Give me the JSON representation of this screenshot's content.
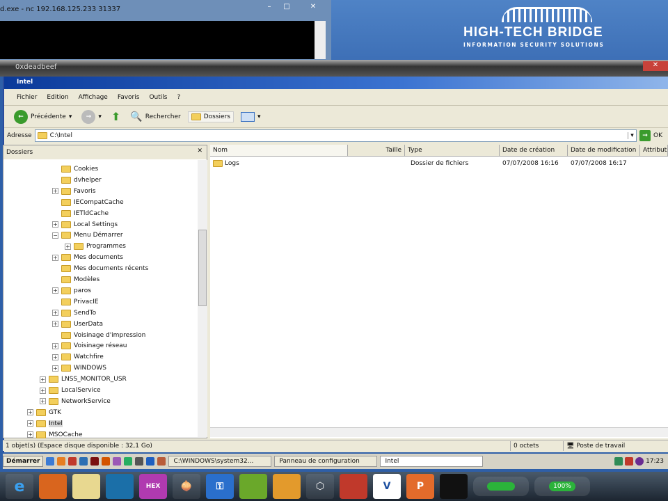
{
  "cmd_window": {
    "title": "d.exe - nc  192.168.125.233 31337"
  },
  "banner": {
    "logo_line1": "HIGH-TECH BRIDGE",
    "logo_line2": "INFORMATION SECURITY SOLUTIONS"
  },
  "outer_window": {
    "title": "0xdeadbeef"
  },
  "explorer": {
    "title": "Intel",
    "menu": [
      "Fichier",
      "Edition",
      "Affichage",
      "Favoris",
      "Outils",
      "?"
    ],
    "toolbar": {
      "back": "Précédente",
      "search": "Rechercher",
      "folders": "Dossiers"
    },
    "address": {
      "label": "Adresse",
      "value": "C:\\Intel",
      "go": "OK"
    },
    "tree": {
      "header": "Dossiers",
      "items": [
        {
          "label": "Cookies",
          "level": 3,
          "exp": ""
        },
        {
          "label": "dvhelper",
          "level": 3,
          "exp": ""
        },
        {
          "label": "Favoris",
          "level": 3,
          "exp": "+"
        },
        {
          "label": "IECompatCache",
          "level": 3,
          "exp": ""
        },
        {
          "label": "IETldCache",
          "level": 3,
          "exp": ""
        },
        {
          "label": "Local Settings",
          "level": 3,
          "exp": "+"
        },
        {
          "label": "Menu Démarrer",
          "level": 3,
          "exp": "−"
        },
        {
          "label": "Programmes",
          "level": 4,
          "exp": "+"
        },
        {
          "label": "Mes documents",
          "level": 3,
          "exp": "+"
        },
        {
          "label": "Mes documents récents",
          "level": 3,
          "exp": ""
        },
        {
          "label": "Modèles",
          "level": 3,
          "exp": ""
        },
        {
          "label": "paros",
          "level": 3,
          "exp": "+"
        },
        {
          "label": "PrivacIE",
          "level": 3,
          "exp": ""
        },
        {
          "label": "SendTo",
          "level": 3,
          "exp": "+"
        },
        {
          "label": "UserData",
          "level": 3,
          "exp": "+"
        },
        {
          "label": "Voisinage d'impression",
          "level": 3,
          "exp": ""
        },
        {
          "label": "Voisinage réseau",
          "level": 3,
          "exp": "+"
        },
        {
          "label": "Watchfire",
          "level": 3,
          "exp": "+"
        },
        {
          "label": "WINDOWS",
          "level": 3,
          "exp": "+"
        },
        {
          "label": "LNSS_MONITOR_USR",
          "level": 2,
          "exp": "+"
        },
        {
          "label": "LocalService",
          "level": 2,
          "exp": "+"
        },
        {
          "label": "NetworkService",
          "level": 2,
          "exp": "+"
        },
        {
          "label": "GTK",
          "level": 1,
          "exp": "+"
        },
        {
          "label": "Intel",
          "level": 1,
          "exp": "+",
          "selected": true
        },
        {
          "label": "MSOCache",
          "level": 1,
          "exp": "+"
        }
      ]
    },
    "columns": [
      "Nom",
      "Taille",
      "Type",
      "Date de création",
      "Date de modification",
      "Attributs"
    ],
    "files": [
      {
        "name": "Logs",
        "size": "",
        "type": "Dossier de fichiers",
        "created": "07/07/2008 16:16",
        "modified": "07/07/2008 16:17"
      }
    ],
    "status": {
      "left": "1 objet(s) (Espace disque disponible : 32,1 Go)",
      "size": "0 octets",
      "location": "Poste de travail"
    }
  },
  "xp_taskbar": {
    "start": "Démarrer",
    "tasks": [
      "C:\\WINDOWS\\system32...",
      "Panneau de configuration",
      "Intel"
    ],
    "clock": "17:23"
  },
  "win7_taskbar": {
    "battery": "100%"
  }
}
